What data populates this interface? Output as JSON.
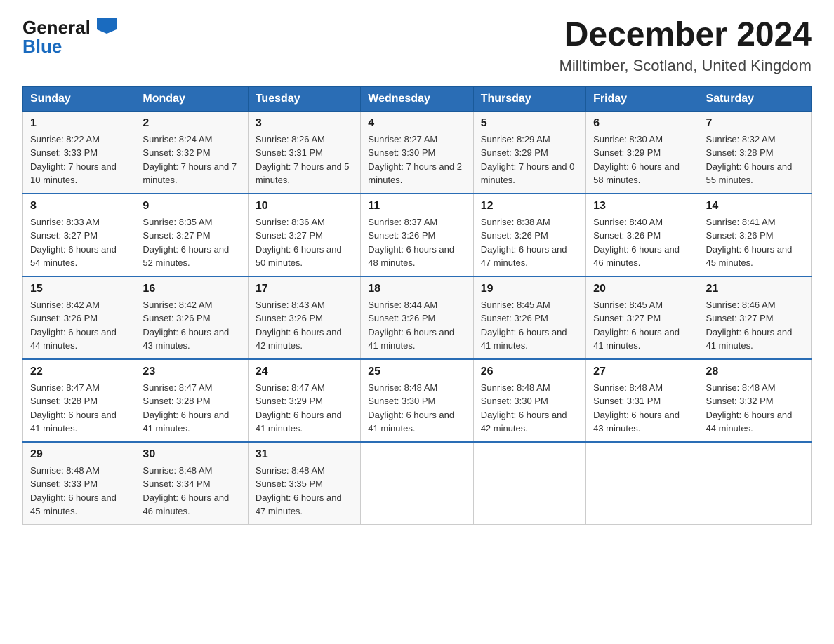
{
  "header": {
    "logo_general": "General",
    "logo_blue": "Blue",
    "title": "December 2024",
    "subtitle": "Milltimber, Scotland, United Kingdom"
  },
  "columns": [
    "Sunday",
    "Monday",
    "Tuesday",
    "Wednesday",
    "Thursday",
    "Friday",
    "Saturday"
  ],
  "weeks": [
    [
      {
        "day": "1",
        "sunrise": "Sunrise: 8:22 AM",
        "sunset": "Sunset: 3:33 PM",
        "daylight": "Daylight: 7 hours and 10 minutes."
      },
      {
        "day": "2",
        "sunrise": "Sunrise: 8:24 AM",
        "sunset": "Sunset: 3:32 PM",
        "daylight": "Daylight: 7 hours and 7 minutes."
      },
      {
        "day": "3",
        "sunrise": "Sunrise: 8:26 AM",
        "sunset": "Sunset: 3:31 PM",
        "daylight": "Daylight: 7 hours and 5 minutes."
      },
      {
        "day": "4",
        "sunrise": "Sunrise: 8:27 AM",
        "sunset": "Sunset: 3:30 PM",
        "daylight": "Daylight: 7 hours and 2 minutes."
      },
      {
        "day": "5",
        "sunrise": "Sunrise: 8:29 AM",
        "sunset": "Sunset: 3:29 PM",
        "daylight": "Daylight: 7 hours and 0 minutes."
      },
      {
        "day": "6",
        "sunrise": "Sunrise: 8:30 AM",
        "sunset": "Sunset: 3:29 PM",
        "daylight": "Daylight: 6 hours and 58 minutes."
      },
      {
        "day": "7",
        "sunrise": "Sunrise: 8:32 AM",
        "sunset": "Sunset: 3:28 PM",
        "daylight": "Daylight: 6 hours and 55 minutes."
      }
    ],
    [
      {
        "day": "8",
        "sunrise": "Sunrise: 8:33 AM",
        "sunset": "Sunset: 3:27 PM",
        "daylight": "Daylight: 6 hours and 54 minutes."
      },
      {
        "day": "9",
        "sunrise": "Sunrise: 8:35 AM",
        "sunset": "Sunset: 3:27 PM",
        "daylight": "Daylight: 6 hours and 52 minutes."
      },
      {
        "day": "10",
        "sunrise": "Sunrise: 8:36 AM",
        "sunset": "Sunset: 3:27 PM",
        "daylight": "Daylight: 6 hours and 50 minutes."
      },
      {
        "day": "11",
        "sunrise": "Sunrise: 8:37 AM",
        "sunset": "Sunset: 3:26 PM",
        "daylight": "Daylight: 6 hours and 48 minutes."
      },
      {
        "day": "12",
        "sunrise": "Sunrise: 8:38 AM",
        "sunset": "Sunset: 3:26 PM",
        "daylight": "Daylight: 6 hours and 47 minutes."
      },
      {
        "day": "13",
        "sunrise": "Sunrise: 8:40 AM",
        "sunset": "Sunset: 3:26 PM",
        "daylight": "Daylight: 6 hours and 46 minutes."
      },
      {
        "day": "14",
        "sunrise": "Sunrise: 8:41 AM",
        "sunset": "Sunset: 3:26 PM",
        "daylight": "Daylight: 6 hours and 45 minutes."
      }
    ],
    [
      {
        "day": "15",
        "sunrise": "Sunrise: 8:42 AM",
        "sunset": "Sunset: 3:26 PM",
        "daylight": "Daylight: 6 hours and 44 minutes."
      },
      {
        "day": "16",
        "sunrise": "Sunrise: 8:42 AM",
        "sunset": "Sunset: 3:26 PM",
        "daylight": "Daylight: 6 hours and 43 minutes."
      },
      {
        "day": "17",
        "sunrise": "Sunrise: 8:43 AM",
        "sunset": "Sunset: 3:26 PM",
        "daylight": "Daylight: 6 hours and 42 minutes."
      },
      {
        "day": "18",
        "sunrise": "Sunrise: 8:44 AM",
        "sunset": "Sunset: 3:26 PM",
        "daylight": "Daylight: 6 hours and 41 minutes."
      },
      {
        "day": "19",
        "sunrise": "Sunrise: 8:45 AM",
        "sunset": "Sunset: 3:26 PM",
        "daylight": "Daylight: 6 hours and 41 minutes."
      },
      {
        "day": "20",
        "sunrise": "Sunrise: 8:45 AM",
        "sunset": "Sunset: 3:27 PM",
        "daylight": "Daylight: 6 hours and 41 minutes."
      },
      {
        "day": "21",
        "sunrise": "Sunrise: 8:46 AM",
        "sunset": "Sunset: 3:27 PM",
        "daylight": "Daylight: 6 hours and 41 minutes."
      }
    ],
    [
      {
        "day": "22",
        "sunrise": "Sunrise: 8:47 AM",
        "sunset": "Sunset: 3:28 PM",
        "daylight": "Daylight: 6 hours and 41 minutes."
      },
      {
        "day": "23",
        "sunrise": "Sunrise: 8:47 AM",
        "sunset": "Sunset: 3:28 PM",
        "daylight": "Daylight: 6 hours and 41 minutes."
      },
      {
        "day": "24",
        "sunrise": "Sunrise: 8:47 AM",
        "sunset": "Sunset: 3:29 PM",
        "daylight": "Daylight: 6 hours and 41 minutes."
      },
      {
        "day": "25",
        "sunrise": "Sunrise: 8:48 AM",
        "sunset": "Sunset: 3:30 PM",
        "daylight": "Daylight: 6 hours and 41 minutes."
      },
      {
        "day": "26",
        "sunrise": "Sunrise: 8:48 AM",
        "sunset": "Sunset: 3:30 PM",
        "daylight": "Daylight: 6 hours and 42 minutes."
      },
      {
        "day": "27",
        "sunrise": "Sunrise: 8:48 AM",
        "sunset": "Sunset: 3:31 PM",
        "daylight": "Daylight: 6 hours and 43 minutes."
      },
      {
        "day": "28",
        "sunrise": "Sunrise: 8:48 AM",
        "sunset": "Sunset: 3:32 PM",
        "daylight": "Daylight: 6 hours and 44 minutes."
      }
    ],
    [
      {
        "day": "29",
        "sunrise": "Sunrise: 8:48 AM",
        "sunset": "Sunset: 3:33 PM",
        "daylight": "Daylight: 6 hours and 45 minutes."
      },
      {
        "day": "30",
        "sunrise": "Sunrise: 8:48 AM",
        "sunset": "Sunset: 3:34 PM",
        "daylight": "Daylight: 6 hours and 46 minutes."
      },
      {
        "day": "31",
        "sunrise": "Sunrise: 8:48 AM",
        "sunset": "Sunset: 3:35 PM",
        "daylight": "Daylight: 6 hours and 47 minutes."
      },
      null,
      null,
      null,
      null
    ]
  ]
}
